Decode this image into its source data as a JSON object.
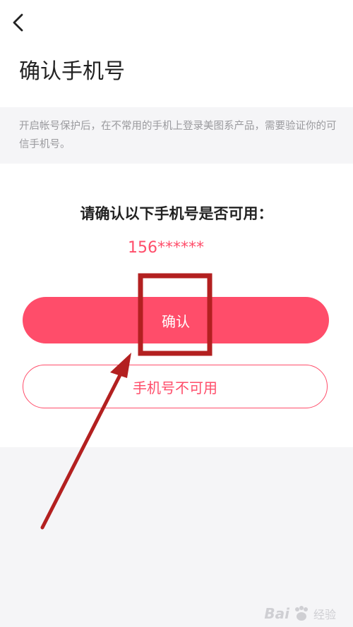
{
  "header": {
    "back_icon": "chevron-left-icon",
    "title": "确认手机号"
  },
  "notice": {
    "text": "开启帐号保护后，在不常用的手机上登录美图系产品，需要验证你的可信手机号。"
  },
  "main": {
    "prompt": "请确认以下手机号是否可用：",
    "phone_masked": "156******",
    "confirm_label": "确认",
    "unavailable_label": "手机号不可用"
  },
  "annotation": {
    "highlight_color": "#b32020"
  },
  "watermark": {
    "brand": "Bai",
    "brand_suffix": "经验"
  },
  "colors": {
    "accent": "#ff4d6a",
    "background": "#f5f5f7",
    "title_text": "#222222",
    "notice_text": "#9a9a9e"
  }
}
